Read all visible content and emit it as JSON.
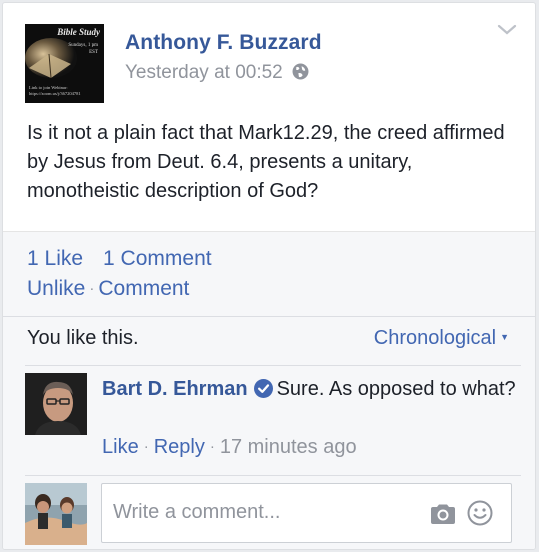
{
  "post": {
    "page_avatar": {
      "title": "Bible Study",
      "subtitle": "Sundays, 1 pm EST",
      "link_text": "Link to join Webinar: https://zoom.us/j/367204781"
    },
    "author": "Anthony F. Buzzard",
    "timestamp": "Yesterday at 00:52",
    "privacy_icon": "globe-icon",
    "text": "Is it not a plain fact that Mark12.29, the creed affirmed by Jesus from Deut. 6.4, presents a unitary, monotheistic description of God?"
  },
  "stats": {
    "likes": "1 Like",
    "comments": "1 Comment",
    "unlike": "Unlike",
    "comment_action": "Comment"
  },
  "ufi": {
    "you_like": "You like this.",
    "order": "Chronological"
  },
  "comments": [
    {
      "name": "Bart D. Ehrman",
      "verified": true,
      "text": "Sure. As opposed to what?",
      "like": "Like",
      "reply": "Reply",
      "time": "17 minutes ago"
    }
  ],
  "composer": {
    "placeholder": "Write a comment..."
  },
  "colors": {
    "link_blue": "#4267b2",
    "name_blue": "#365899",
    "muted_gray": "#90949c",
    "panel_bg": "#f6f7f9"
  }
}
